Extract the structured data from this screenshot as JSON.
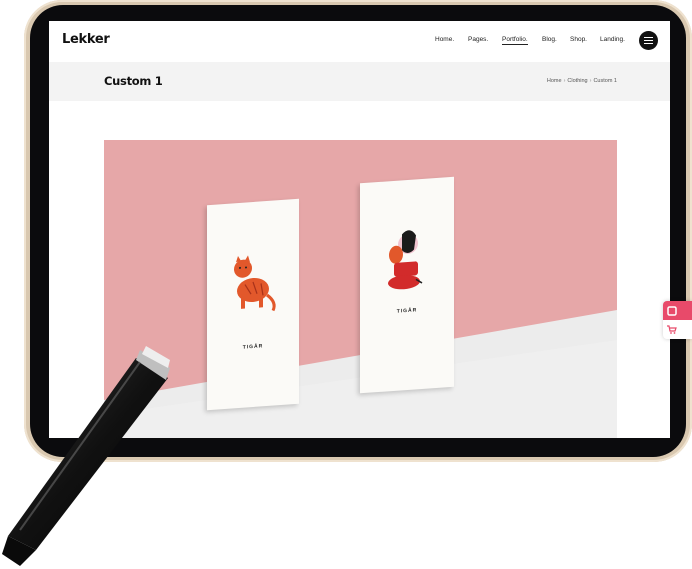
{
  "site": {
    "logo": "Lekker",
    "nav": [
      {
        "label": "Home."
      },
      {
        "label": "Pages."
      },
      {
        "label": "Portfolio.",
        "active": true
      },
      {
        "label": "Blog."
      },
      {
        "label": "Shop."
      },
      {
        "label": "Landing."
      }
    ],
    "menu_icon": "hamburger-icon"
  },
  "page": {
    "title": "Custom 1",
    "breadcrumb": [
      "Home",
      "Clothing",
      "Custom 1"
    ]
  },
  "hero": {
    "cards": [
      {
        "label": "TIGÅR",
        "illustration": "tiger-icon"
      },
      {
        "label": "TIGÅR",
        "illustration": "woman-with-cat-icon"
      }
    ]
  },
  "side_widget": {
    "top_icon": "fullscreen-icon",
    "bottom_icon": "cart-icon"
  },
  "colors": {
    "hero_background": "#e6a7a8",
    "accent": "#e84a6a",
    "device_frame": "#d9c8b0",
    "title_bar": "#f3f3f3"
  }
}
